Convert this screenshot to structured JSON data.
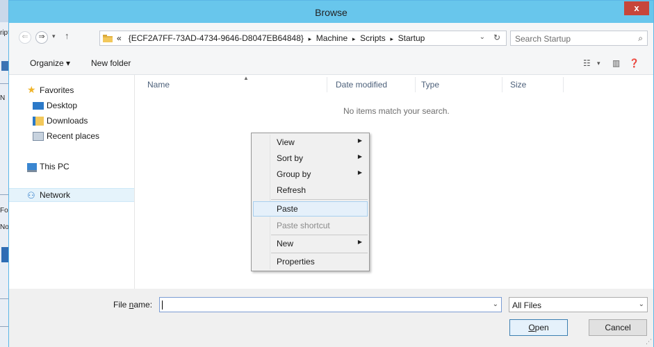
{
  "window": {
    "title": "Browse",
    "close_glyph": "x"
  },
  "background_window": {
    "fragments": [
      "ript",
      "N",
      "For",
      "Not"
    ]
  },
  "address_bar": {
    "overflow": "«",
    "crumbs": [
      "{ECF2A7FF-73AD-4734-9646-D8047EB64848}",
      "Machine",
      "Scripts",
      "Startup"
    ],
    "separator": "▸"
  },
  "search": {
    "placeholder": "Search Startup"
  },
  "toolbar": {
    "organize_label": "Organize ▾",
    "new_folder_label": "New folder"
  },
  "sidebar": {
    "items": [
      {
        "label": "Favorites",
        "icon": "star-icon"
      },
      {
        "label": "Desktop",
        "icon": "desktop-icon"
      },
      {
        "label": "Downloads",
        "icon": "downloads-icon"
      },
      {
        "label": "Recent places",
        "icon": "recent-places-icon"
      },
      {
        "label": "This PC",
        "icon": "computer-icon"
      },
      {
        "label": "Network",
        "icon": "network-icon",
        "selected": true
      }
    ]
  },
  "file_list": {
    "columns": [
      "Name",
      "Date modified",
      "Type",
      "Size"
    ],
    "empty_message": "No items match your search."
  },
  "context_menu": {
    "items": [
      {
        "label": "View",
        "submenu": true
      },
      {
        "label": "Sort by",
        "submenu": true
      },
      {
        "label": "Group by",
        "submenu": true
      },
      {
        "label": "Refresh"
      },
      {
        "label": "Paste",
        "highlighted": true
      },
      {
        "label": "Paste shortcut",
        "disabled": true
      },
      {
        "label": "New",
        "submenu": true
      },
      {
        "label": "Properties"
      }
    ]
  },
  "bottom": {
    "file_name_label_pre": "File ",
    "file_name_label_u": "n",
    "file_name_label_post": "ame:",
    "file_name_value": "",
    "filter_value": "All Files",
    "open_label_u": "O",
    "open_label_rest": "pen",
    "cancel_label": "Cancel"
  },
  "colors": {
    "titlebar": "#68c6ec",
    "close": "#c7463a",
    "selection": "#e5f3fb"
  }
}
